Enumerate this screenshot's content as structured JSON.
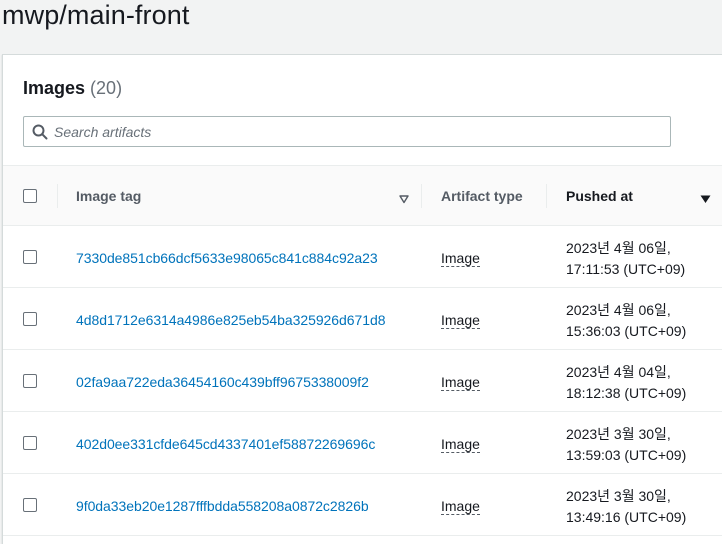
{
  "repository": {
    "name": "mwp/main-front"
  },
  "images_panel": {
    "title": "Images",
    "count": "(20)",
    "search": {
      "placeholder": "Search artifacts",
      "value": ""
    }
  },
  "table": {
    "columns": [
      {
        "label": "Image tag",
        "sort": "sortable"
      },
      {
        "label": "Artifact type",
        "sort": "none"
      },
      {
        "label": "Pushed at",
        "sort": "descending"
      }
    ],
    "rows": [
      {
        "image_tag": "7330de851cb66dcf5633e98065c841c884c92a23",
        "artifact_type": "Image",
        "pushed_date": "2023년 4월 06일,",
        "pushed_time": "17:11:53 (UTC+09)"
      },
      {
        "image_tag": "4d8d1712e6314a4986e825eb54ba325926d671d8",
        "artifact_type": "Image",
        "pushed_date": "2023년 4월 06일,",
        "pushed_time": "15:36:03 (UTC+09)"
      },
      {
        "image_tag": "02fa9aa722eda36454160c439bff9675338009f2",
        "artifact_type": "Image",
        "pushed_date": "2023년 4월 04일,",
        "pushed_time": "18:12:38 (UTC+09)"
      },
      {
        "image_tag": "402d0ee331cfde645cd4337401ef58872269696c",
        "artifact_type": "Image",
        "pushed_date": "2023년 3월 30일,",
        "pushed_time": "13:59:03 (UTC+09)"
      },
      {
        "image_tag": "9f0da33eb20e1287fffbdda558208a0872c2826b",
        "artifact_type": "Image",
        "pushed_date": "2023년 3월 30일,",
        "pushed_time": "13:49:16 (UTC+09)"
      }
    ]
  },
  "icons": {
    "search": "search-icon",
    "sort_sortable": "caret-down-outline-icon",
    "sort_descending": "caret-down-filled-icon"
  },
  "colors": {
    "link": "#0073bb",
    "text": "#16191f",
    "header_text": "#545b64",
    "muted": "#687078",
    "page_bg": "#f2f3f3",
    "panel_bg": "#ffffff"
  }
}
